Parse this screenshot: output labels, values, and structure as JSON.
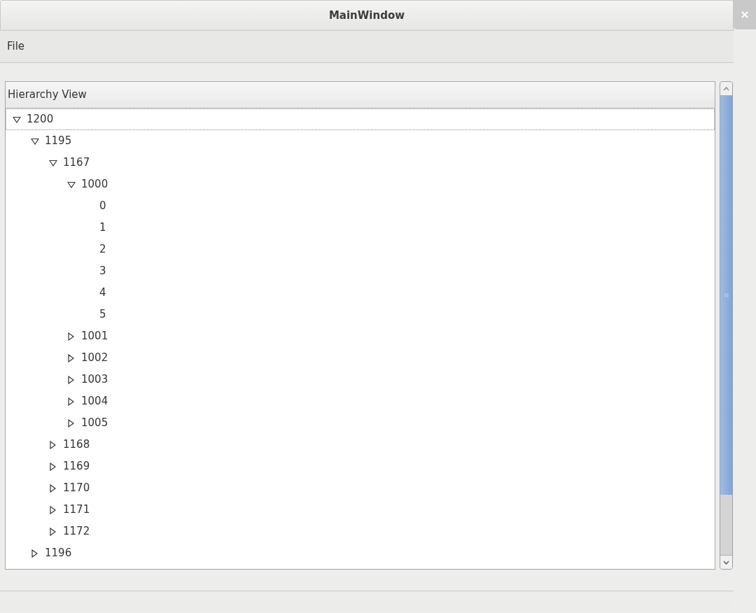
{
  "window": {
    "title": "MainWindow"
  },
  "menu": [
    "File"
  ],
  "tree": {
    "header": "Hierarchy View",
    "items": [
      {
        "label": "1200",
        "expanded": true,
        "focused": true,
        "children": [
          {
            "label": "1195",
            "expanded": true,
            "focused": false,
            "children": [
              {
                "label": "1167",
                "expanded": true,
                "focused": false,
                "children": [
                  {
                    "label": "1000",
                    "expanded": true,
                    "focused": false,
                    "children": [
                      {
                        "label": "0",
                        "focused": false
                      },
                      {
                        "label": "1",
                        "focused": false
                      },
                      {
                        "label": "2",
                        "focused": false
                      },
                      {
                        "label": "3",
                        "focused": false
                      },
                      {
                        "label": "4",
                        "focused": false
                      },
                      {
                        "label": "5",
                        "focused": false
                      }
                    ]
                  },
                  {
                    "label": "1001",
                    "expanded": false,
                    "focused": false
                  },
                  {
                    "label": "1002",
                    "expanded": false,
                    "focused": false
                  },
                  {
                    "label": "1003",
                    "expanded": false,
                    "focused": false
                  },
                  {
                    "label": "1004",
                    "expanded": false,
                    "focused": false
                  },
                  {
                    "label": "1005",
                    "expanded": false,
                    "focused": false
                  }
                ]
              },
              {
                "label": "1168",
                "expanded": false,
                "focused": false
              },
              {
                "label": "1169",
                "expanded": false,
                "focused": false
              },
              {
                "label": "1170",
                "expanded": false,
                "focused": false
              },
              {
                "label": "1171",
                "expanded": false,
                "focused": false
              },
              {
                "label": "1172",
                "expanded": false,
                "focused": false
              }
            ]
          },
          {
            "label": "1196",
            "expanded": false,
            "focused": false
          }
        ]
      }
    ]
  }
}
